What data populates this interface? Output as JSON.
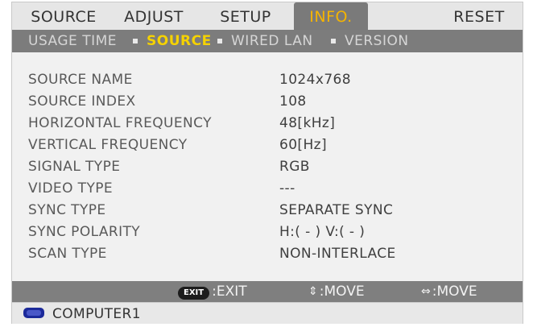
{
  "menu": {
    "tabs": [
      {
        "label": "SOURCE",
        "active": false
      },
      {
        "label": "ADJUST",
        "active": false
      },
      {
        "label": "SETUP",
        "active": false
      },
      {
        "label": "INFO.",
        "active": true
      },
      {
        "label": "RESET",
        "active": false
      }
    ]
  },
  "subtabs": [
    {
      "label": "USAGE TIME",
      "active": false
    },
    {
      "label": "SOURCE",
      "active": true
    },
    {
      "label": "WIRED LAN",
      "active": false
    },
    {
      "label": "VERSION",
      "active": false
    }
  ],
  "info": [
    {
      "label": "SOURCE NAME",
      "value": "1024x768"
    },
    {
      "label": "SOURCE INDEX",
      "value": "108"
    },
    {
      "label": "HORIZONTAL FREQUENCY",
      "value": "48[kHz]"
    },
    {
      "label": "VERTICAL FREQUENCY",
      "value": "60[Hz]"
    },
    {
      "label": "SIGNAL TYPE",
      "value": "RGB"
    },
    {
      "label": "VIDEO TYPE",
      "value": "---"
    },
    {
      "label": "SYNC TYPE",
      "value": "SEPARATE SYNC"
    },
    {
      "label": "SYNC POLARITY",
      "value": "H:( - ) V:( - )"
    },
    {
      "label": "SCAN TYPE",
      "value": "NON-INTERLACE"
    }
  ],
  "help": {
    "exit_key": "EXIT",
    "exit_label": ":EXIT",
    "move_vertical_label": ":MOVE",
    "move_horizontal_label": ":MOVE",
    "vertical_icon": "up-down-arrows-icon",
    "horizontal_icon": "left-right-arrows-icon"
  },
  "status": {
    "source": "COMPUTER1",
    "icon": "computer-input-icon"
  },
  "colors": {
    "active_tab_text": "#f5b400",
    "active_subtab_text": "#f5d200",
    "bar_gray": "#7c7c7c",
    "source_icon": "#1c2a9a"
  }
}
